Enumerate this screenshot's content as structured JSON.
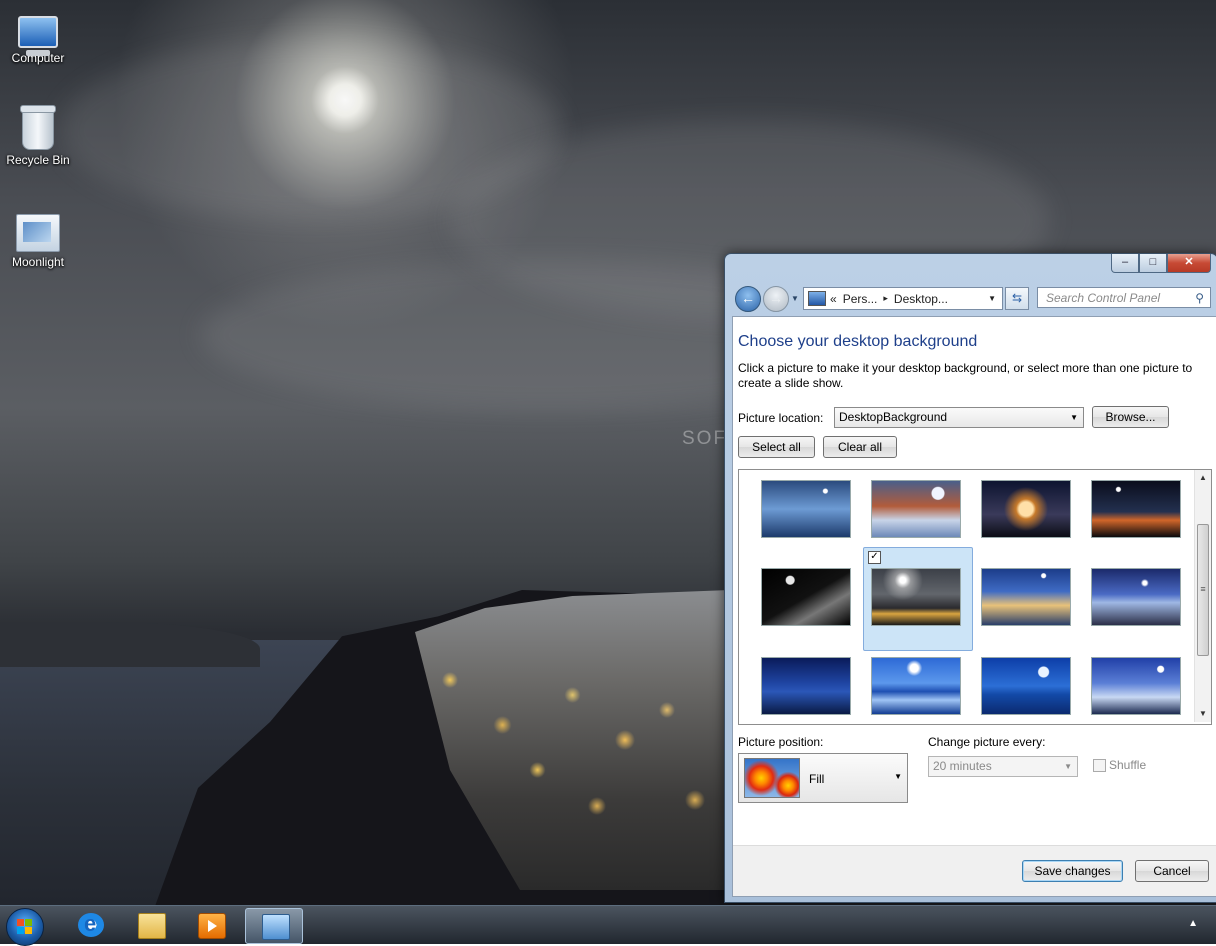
{
  "desktop_icons": [
    {
      "label": "Computer",
      "icon": "computer-icon"
    },
    {
      "label": "Recycle Bin",
      "icon": "recycle-bin-icon"
    },
    {
      "label": "Moonlight",
      "icon": "theme-file-icon"
    }
  ],
  "watermark": "SOFTPEDIA",
  "window": {
    "controls": {
      "minimize": "–",
      "maximize": "□",
      "close": "✕"
    },
    "address": {
      "segment1": "Pers...",
      "segment2": "Desktop...",
      "prefix": "«",
      "separator": "▸"
    },
    "search_placeholder": "Search Control Panel",
    "title": "Choose your desktop background",
    "description": "Click a picture to make it your desktop background, or select more than one picture to create a slide show.",
    "picture_location_label": "Picture location:",
    "picture_location_value": "DesktopBackground",
    "browse_label": "Browse...",
    "select_all_label": "Select all",
    "clear_all_label": "Clear all",
    "thumbnails": [
      {
        "name": "sea-rocks-moon",
        "selected": false
      },
      {
        "name": "red-canyon-moon",
        "selected": false
      },
      {
        "name": "moon-over-clouds",
        "selected": false
      },
      {
        "name": "lakeside-night",
        "selected": false
      },
      {
        "name": "moon-grass",
        "selected": false
      },
      {
        "name": "santorini-moonlight",
        "selected": true
      },
      {
        "name": "castle-night",
        "selected": false
      },
      {
        "name": "lighthouse-coast",
        "selected": false
      },
      {
        "name": "blue-mountains",
        "selected": false
      },
      {
        "name": "moon-reflection",
        "selected": false
      },
      {
        "name": "crescent-sea",
        "selected": false
      },
      {
        "name": "snowy-forest",
        "selected": false
      }
    ],
    "picture_position_label": "Picture position:",
    "picture_position_value": "Fill",
    "change_picture_label": "Change picture every:",
    "change_picture_value": "20 minutes",
    "shuffle_label": "Shuffle",
    "save_label": "Save changes",
    "cancel_label": "Cancel"
  },
  "taskbar": {
    "items": [
      "internet-explorer",
      "windows-explorer",
      "windows-media-player",
      "control-panel"
    ],
    "active_item": "control-panel",
    "tray_arrow": "▲"
  },
  "colors": {
    "heading": "#1e3f8a",
    "selection": "#cce4f7",
    "window_frame": "#bcd0e6"
  }
}
